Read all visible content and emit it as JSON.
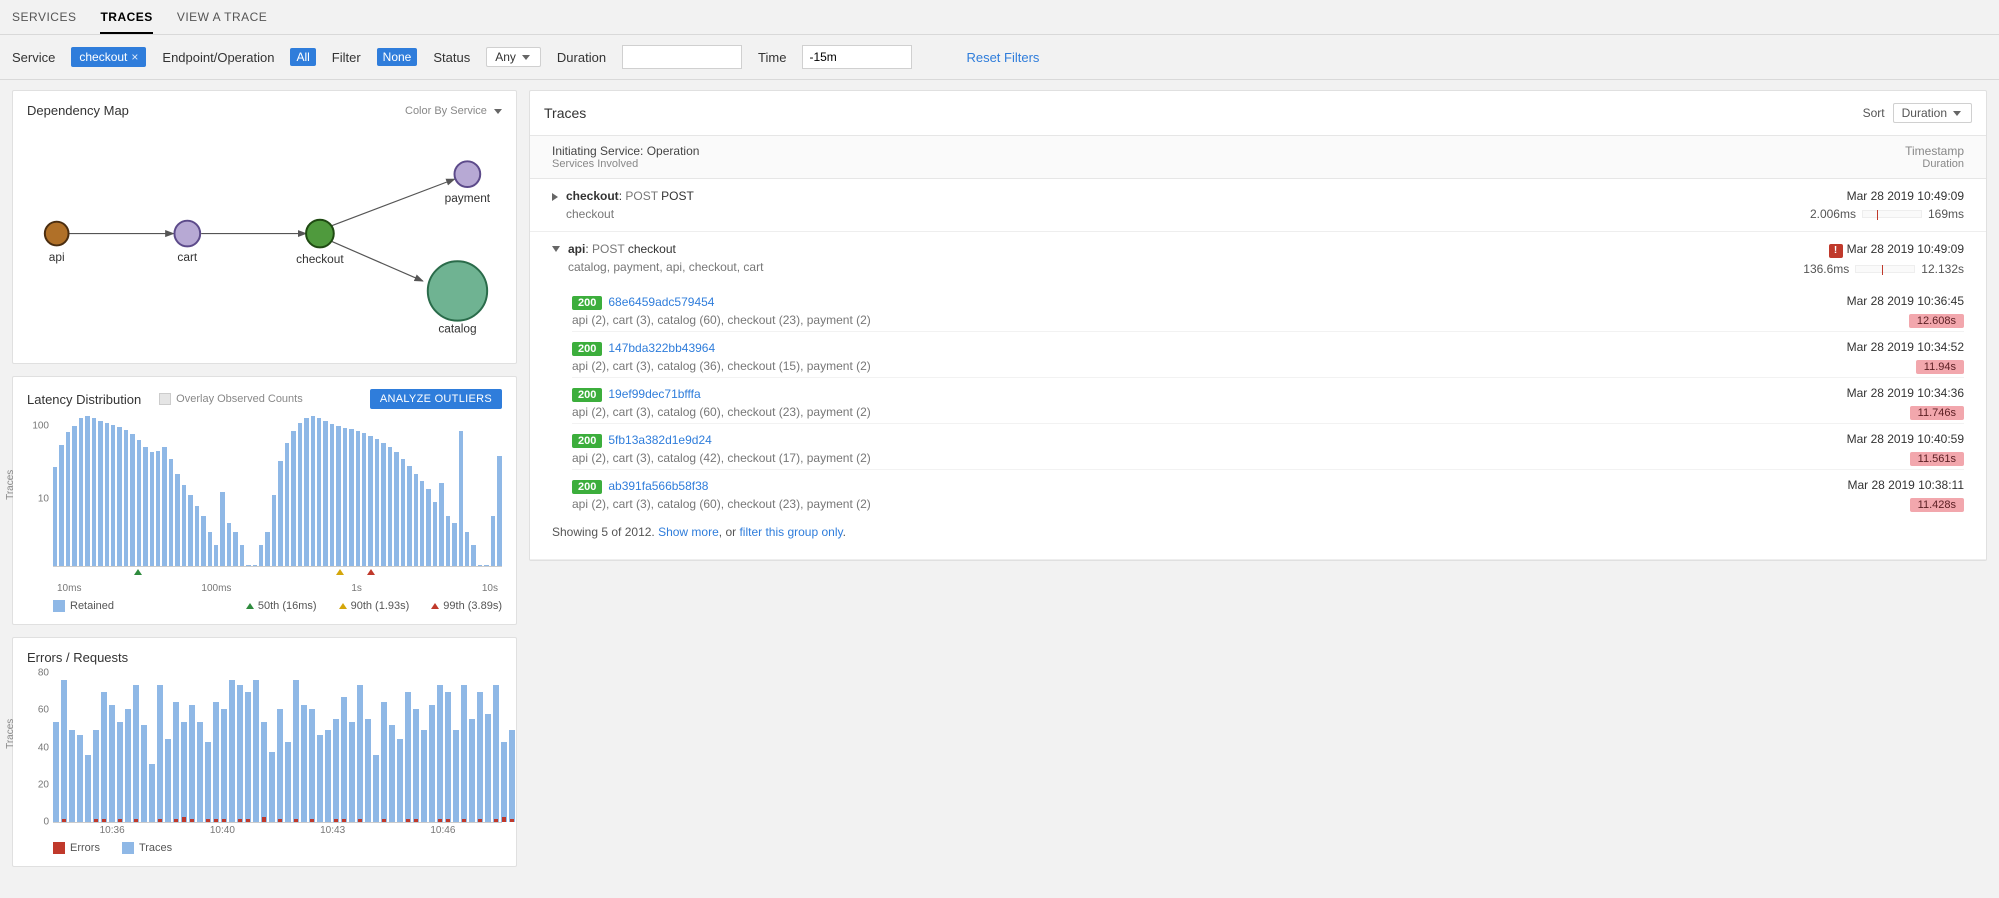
{
  "tabs": {
    "services": "SERVICES",
    "traces": "TRACES",
    "view_trace": "VIEW A TRACE"
  },
  "filters": {
    "service_label": "Service",
    "service_value": "checkout",
    "endpoint_label": "Endpoint/Operation",
    "endpoint_value": "All",
    "filter_label": "Filter",
    "filter_value": "None",
    "status_label": "Status",
    "status_value": "Any",
    "duration_label": "Duration",
    "duration_value": "",
    "time_label": "Time",
    "time_value": "-15m",
    "reset": "Reset Filters"
  },
  "dep_map": {
    "title": "Dependency Map",
    "colorby_label": "Color By",
    "colorby_value": "Service",
    "nodes": {
      "api": "api",
      "cart": "cart",
      "checkout": "checkout",
      "payment": "payment",
      "catalog": "catalog"
    }
  },
  "latency": {
    "title": "Latency Distribution",
    "overlay_label": "Overlay Observed Counts",
    "analyze_btn": "ANALYZE OUTLIERS",
    "legend_retained": "Retained",
    "p50": "50th (16ms)",
    "p90": "90th (1.93s)",
    "p99": "99th (3.89s)",
    "axis_title": "Traces"
  },
  "errors": {
    "title": "Errors / Requests",
    "legend_errors": "Errors",
    "legend_traces": "Traces",
    "axis_title": "Traces"
  },
  "traces": {
    "title": "Traces",
    "sort_label": "Sort",
    "sort_value": "Duration",
    "head_left1": "Initiating Service: Operation",
    "head_left2": "Services Involved",
    "head_right1": "Timestamp",
    "head_right2": "Duration",
    "group1": {
      "svc": "checkout",
      "op": "POST",
      "path": "POST",
      "involved": "checkout",
      "ts": "Mar 28 2019 10:49:09",
      "min": "2.006ms",
      "max": "169ms"
    },
    "group2": {
      "svc": "api",
      "op": "POST",
      "path": "checkout",
      "involved": "catalog, payment, api, checkout, cart",
      "ts": "Mar 28 2019 10:49:09",
      "min": "136.6ms",
      "max": "12.132s",
      "rows": [
        {
          "status": "200",
          "id": "68e6459adc579454",
          "sub": "api (2), cart (3), catalog (60), checkout (23), payment (2)",
          "ts": "Mar 28 2019 10:36:45",
          "dur": "12.608s"
        },
        {
          "status": "200",
          "id": "147bda322bb43964",
          "sub": "api (2), cart (3), catalog (36), checkout (15), payment (2)",
          "ts": "Mar 28 2019 10:34:52",
          "dur": "11.94s"
        },
        {
          "status": "200",
          "id": "19ef99dec71bfffa",
          "sub": "api (2), cart (3), catalog (60), checkout (23), payment (2)",
          "ts": "Mar 28 2019 10:34:36",
          "dur": "11.746s"
        },
        {
          "status": "200",
          "id": "5fb13a382d1e9d24",
          "sub": "api (2), cart (3), catalog (42), checkout (17), payment (2)",
          "ts": "Mar 28 2019 10:40:59",
          "dur": "11.561s"
        },
        {
          "status": "200",
          "id": "ab391fa566b58f38",
          "sub": "api (2), cart (3), catalog (60), checkout (23), payment (2)",
          "ts": "Mar 28 2019 10:38:11",
          "dur": "11.428s"
        }
      ]
    },
    "footer_prefix": "Showing 5 of 2012. ",
    "footer_show_more": "Show more",
    "footer_mid": ", or ",
    "footer_filter": "filter this group only",
    "footer_suffix": "."
  },
  "chart_data": [
    {
      "type": "bar",
      "title": "Latency Distribution",
      "xlabel": "",
      "ylabel": "Traces",
      "xscale": "log",
      "yscale": "log",
      "ylim": [
        1,
        150
      ],
      "xticks": [
        "10ms",
        "100ms",
        "1s",
        "10s"
      ],
      "yticks": [
        10,
        100
      ],
      "percentiles": {
        "p50": "16ms",
        "p90": "1.93s",
        "p99": "3.89s"
      },
      "values": [
        25,
        50,
        78,
        95,
        120,
        128,
        120,
        112,
        105,
        98,
        90,
        82,
        72,
        60,
        48,
        40,
        42,
        48,
        32,
        20,
        14,
        10,
        7,
        5,
        3,
        2,
        11,
        4,
        3,
        2,
        1,
        1,
        2,
        3,
        10,
        30,
        55,
        80,
        105,
        120,
        128,
        122,
        112,
        100,
        94,
        88,
        84,
        80,
        74,
        68,
        62,
        55,
        48,
        40,
        32,
        26,
        20,
        16,
        12,
        8,
        15,
        5,
        4,
        80,
        3,
        2,
        1,
        1,
        5,
        35
      ]
    },
    {
      "type": "bar",
      "title": "Errors / Requests",
      "xlabel": "",
      "ylabel": "Traces",
      "ylim": [
        0,
        90
      ],
      "yticks": [
        0,
        20,
        40,
        60,
        80
      ],
      "xticks": [
        "10:36",
        "10:40",
        "10:43",
        "10:46"
      ],
      "series": [
        {
          "name": "Traces",
          "values": [
            60,
            85,
            55,
            52,
            40,
            55,
            78,
            70,
            60,
            68,
            82,
            58,
            35,
            82,
            50,
            72,
            60,
            70,
            60,
            48,
            72,
            68,
            85,
            82,
            78,
            85,
            60,
            42,
            68,
            48,
            85,
            70,
            68,
            52,
            55,
            62,
            75,
            60,
            82,
            62,
            40,
            72,
            58,
            50,
            78,
            68,
            55,
            70,
            82,
            78,
            55,
            82,
            62,
            78,
            65,
            82,
            48,
            55
          ]
        },
        {
          "name": "Errors",
          "values": [
            0,
            2,
            0,
            0,
            0,
            2,
            2,
            0,
            2,
            0,
            2,
            0,
            0,
            2,
            0,
            2,
            3,
            2,
            0,
            2,
            2,
            2,
            0,
            2,
            2,
            0,
            3,
            0,
            2,
            0,
            2,
            0,
            2,
            0,
            0,
            2,
            2,
            0,
            2,
            0,
            0,
            2,
            0,
            0,
            2,
            2,
            0,
            0,
            2,
            2,
            0,
            2,
            0,
            2,
            0,
            2,
            3,
            2
          ]
        }
      ]
    }
  ]
}
